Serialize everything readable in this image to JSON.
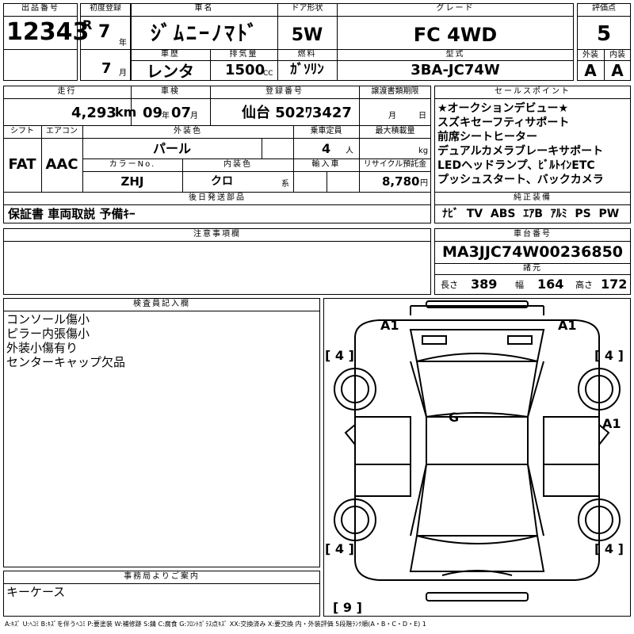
{
  "header_labels": {
    "lot_no": "出品番号",
    "first_reg": "初度登録",
    "car_name": "車名",
    "door": "ドア形状",
    "grade": "グレード",
    "score": "評価点",
    "year_unit": "年",
    "month_unit": "月",
    "history": "車歴",
    "displacement": "排気量",
    "fuel": "燃料",
    "model_code": "型式",
    "exterior": "外装",
    "interior": "内装",
    "mileage": "走行",
    "inspection": "車検",
    "reg_no": "登録番号",
    "transfer_deadline": "譲渡書類期限",
    "sales_points": "セールスポイント",
    "shift": "シフト",
    "aircon": "エアコン",
    "ext_color": "外装色",
    "capacity": "乗車定員",
    "max_load": "最大積載量",
    "color_no": "カラーNo.",
    "int_color": "内装色",
    "import": "輸入車",
    "recycle": "リサイクル預託金",
    "later_parts": "後日発送部品",
    "std_equipment": "純正装備",
    "notes": "注意事項欄",
    "chassis_no": "車台番号",
    "specs": "諸元",
    "inspector": "検査員記入欄",
    "office": "事務局よりご案内"
  },
  "lot_no": "12343",
  "era": "R",
  "reg_year": "7",
  "reg_month": "7",
  "car_name": "ｼﾞﾑﾆｰﾉﾏﾄﾞ",
  "door": "5W",
  "grade": "FC 4WD",
  "score": "5",
  "history": "レンタ",
  "displacement": "1500",
  "cc_unit": "CC",
  "fuel": "ｶﾞｿﾘﾝ",
  "model_code": "3BA-JC74W",
  "exterior_score": "A",
  "interior_score": "A",
  "mileage": "4,293",
  "km_unit": "km",
  "inspection_year": "09",
  "inspection_month": "07",
  "reg_no": "仙台 502ﾜ3427",
  "deadline_month_unit": "月",
  "deadline_day_unit": "日",
  "shift": "FAT",
  "aircon": "AAC",
  "ext_color": "パール",
  "capacity": "4",
  "capacity_unit": "人",
  "kg_unit": "kg",
  "color_no": "ZHJ",
  "int_color": "クロ",
  "int_color_suffix": "系",
  "recycle": "8,780",
  "yen_unit": "円",
  "later_parts": "保証書 車両取説 予備ｷｰ",
  "sales_points": [
    "★オークションデビュー★",
    "スズキセーフティサポート",
    "前席シートヒーター",
    "デュアルカメラブレーキサポート",
    "LEDヘッドランプ、ﾋﾞﾙﾄｲﾝETC",
    "プッシュスタート、バックカメラ"
  ],
  "std_equipment": "ﾅﾋﾞ  TV  ABS  ｴｱB  ｱﾙﾐ  PS  PW",
  "chassis_no": "MA3JJC74W00236850",
  "length_label": "長さ",
  "length": "389",
  "width_label": "幅",
  "width": "164",
  "height_label": "高さ",
  "height": "172",
  "inspector_notes": [
    "コンソール傷小",
    "ピラー内張傷小",
    "外装小傷有り",
    "センターキャップ欠品"
  ],
  "office_note": "キーケース",
  "diagram_marks": {
    "front_left": "A1",
    "front_right": "A1",
    "glass": "G",
    "right_side": "A1",
    "tire_fl": "[ 4 ]",
    "tire_fr": "[ 4 ]",
    "tire_rl": "[ 4 ]",
    "tire_rr": "[ 4 ]",
    "spare": "[ 9 ]"
  },
  "legend": "A:ｷｽﾞ U:ﾍｺﾐ B:ｷｽﾞを伴うﾍｺﾐ P:要塗装 W:補修跡 S:錆 C:腐食 G:ﾌﾛﾝﾄｶﾞﾗｽ点ｷｽﾞ XX:交換済み X:要交換 内・外装評価 5段階ﾗﾝｸ順(A・B・C・D・E) 1"
}
